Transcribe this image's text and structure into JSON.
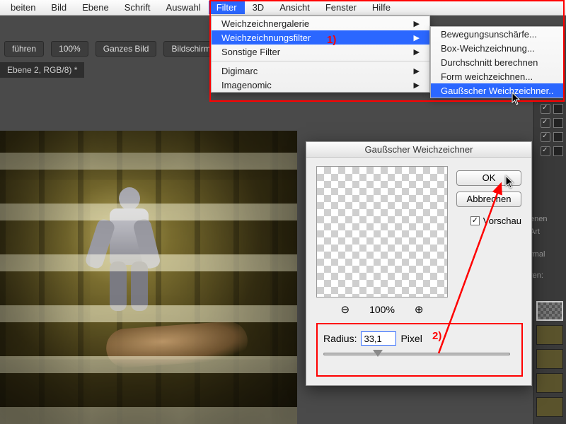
{
  "menubar": {
    "items": [
      "beiten",
      "Bild",
      "Ebene",
      "Schrift",
      "Auswahl",
      "Filter",
      "3D",
      "Ansicht",
      "Fenster",
      "Hilfe"
    ],
    "active_index": 5
  },
  "toolbar": {
    "btn_fuehren": "führen",
    "btn_zoom": "100%",
    "btn_ganzes": "Ganzes Bild",
    "btn_bildschirm": "Bildschirm aus"
  },
  "doctab": "Ebene 2, RGB/8) *",
  "dropdown": {
    "items": [
      {
        "label": "Weichzeichnergalerie",
        "arrow": true
      },
      {
        "label": "Weichzeichnungsfilter",
        "arrow": true,
        "hl": true
      },
      {
        "label": "Sonstige Filter",
        "arrow": true
      },
      {
        "sep": true
      },
      {
        "label": "Digimarc",
        "arrow": true
      },
      {
        "label": "Imagenomic",
        "arrow": true
      }
    ]
  },
  "submenu": {
    "items": [
      {
        "label": "Bewegungsunschärfe..."
      },
      {
        "label": "Box-Weichzeichnung..."
      },
      {
        "label": "Durchschnitt berechnen"
      },
      {
        "label": "Form weichzeichnen..."
      },
      {
        "label": "Gaußscher Weichzeichner..",
        "hl": true
      }
    ]
  },
  "dialog": {
    "title": "Gaußscher Weichzeichner",
    "ok": "OK",
    "cancel": "Abbrechen",
    "preview_label": "Vorschau",
    "zoom_pct": "100%",
    "radius_label": "Radius:",
    "radius_value": "33,1",
    "radius_unit": "Pixel"
  },
  "annotations": {
    "step1": "1)",
    "step2": "2)"
  },
  "rpanel": {
    "labels": [
      "enen",
      "Art",
      "rmal",
      "ren:"
    ]
  }
}
